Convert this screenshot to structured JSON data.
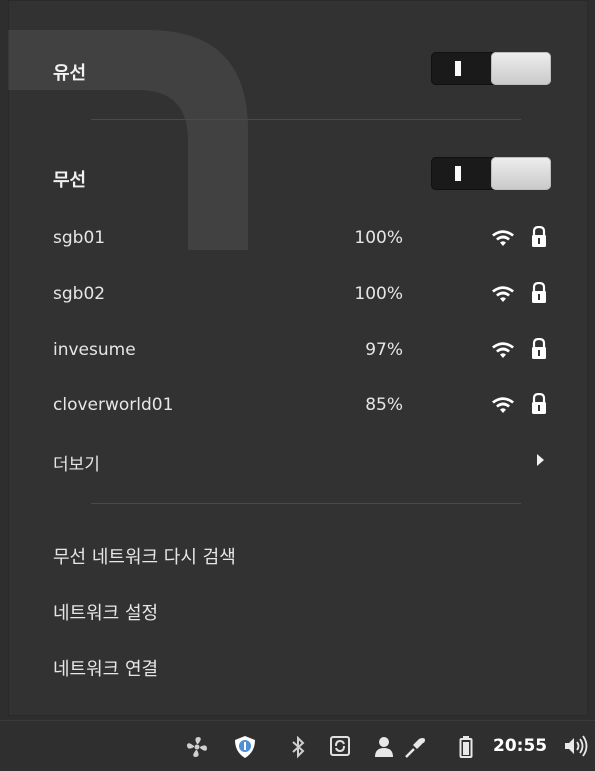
{
  "wired": {
    "title": "유선"
  },
  "wireless": {
    "title": "무선",
    "networks": [
      {
        "ssid": "sgb01",
        "strength": "100%",
        "icon": "wifi-icon",
        "secured": true
      },
      {
        "ssid": "sgb02",
        "strength": "100%",
        "icon": "wifi-icon",
        "secured": true
      },
      {
        "ssid": "invesume",
        "strength": "97%",
        "icon": "wifi-icon",
        "secured": true
      },
      {
        "ssid": "cloverworld01",
        "strength": "85%",
        "icon": "wifi-icon",
        "secured": true
      }
    ],
    "more_label": "더보기"
  },
  "actions": {
    "rescan": "무선 네트워크 다시 검색",
    "settings": "네트워크 설정",
    "connections": "네트워크 연결"
  },
  "taskbar": {
    "time": "20:55",
    "icons": [
      "fan-icon",
      "shield-icon",
      "bluetooth-icon",
      "update-icon",
      "user-icon",
      "network-plug-icon",
      "battery-icon",
      "volume-icon"
    ]
  },
  "colors": {
    "panel_bg": "#323232",
    "text": "#e6e6e6",
    "toggle_bg": "#1a1a1a",
    "toggle_knob": "#e0e0e0",
    "shield_accent": "#4f8fd6"
  }
}
